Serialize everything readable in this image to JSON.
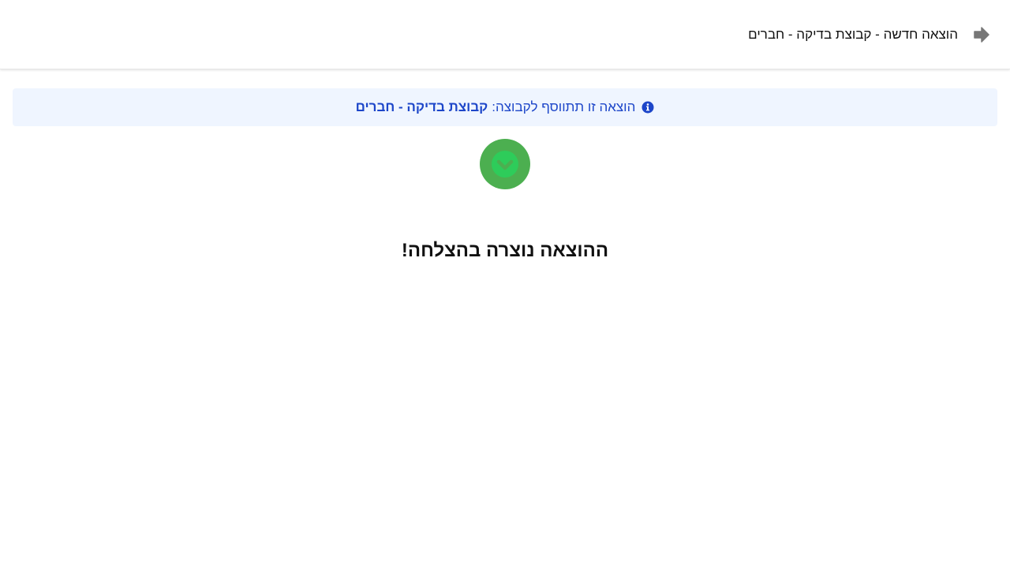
{
  "header": {
    "title": "הוצאה חדשה - קבוצת בדיקה - חברים",
    "back_icon": "arrow-right-icon"
  },
  "info_banner": {
    "icon": "info-circle-icon",
    "text": "הוצאה זו תתווסף לקבוצה:",
    "group_name": "קבוצת בדיקה - חברים"
  },
  "success": {
    "icon": "check-circle-icon",
    "title": "ההוצאה נוצרה בהצלחה!"
  },
  "colors": {
    "info_background": "#eff5ff",
    "info_text": "#1d46c9",
    "success_circle": "#4caf50",
    "success_check": "#2ecc5a",
    "back_icon": "#777777"
  }
}
